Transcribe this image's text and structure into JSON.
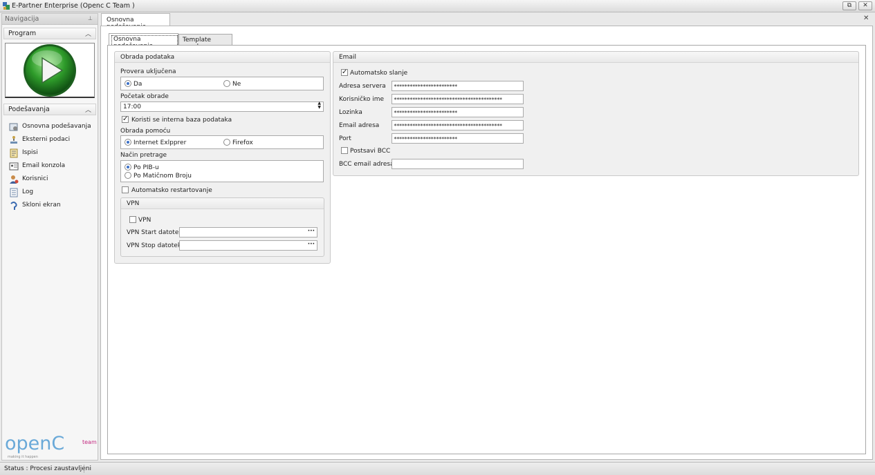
{
  "window": {
    "title": "E-Partner Enterprise (Openc C Team )"
  },
  "nav": {
    "header": "Navigacija",
    "program_group": "Program",
    "settings_group": "Podešavanja",
    "items": [
      {
        "label": "Osnovna podešavanja",
        "icon": "settings-icon"
      },
      {
        "label": "Eksterni podaci",
        "icon": "external-data-icon"
      },
      {
        "label": "Ispisi",
        "icon": "reports-icon"
      },
      {
        "label": "Email konzola",
        "icon": "email-console-icon"
      },
      {
        "label": "Korisnici",
        "icon": "users-icon"
      },
      {
        "label": "Log",
        "icon": "log-icon"
      },
      {
        "label": "Skloni ekran",
        "icon": "hide-screen-icon"
      }
    ],
    "brand_main": "openC",
    "brand_team": "team",
    "brand_tagline": "making it happen"
  },
  "document": {
    "tab_label": "Osnovna podešavanja",
    "tabs": [
      "Osnovna podešavanja",
      "Template poruke"
    ]
  },
  "processing": {
    "title": "Obrada podataka",
    "check_label": "Provera uključena",
    "check_options": [
      "Da",
      "Ne"
    ],
    "check_selected": "Da",
    "start_label": "Početak obrade",
    "start_value": "17:00",
    "internal_db_label": "Koristi se interna baza podataka",
    "internal_db_checked": true,
    "via_label": "Obrada pomoću",
    "via_options": [
      "Internet Exlpprer",
      "Firefox"
    ],
    "via_selected": "Internet Exlpprer",
    "search_label": "Način pretrage",
    "search_options": [
      "Po PIB-u",
      "Po Matičnom Broju"
    ],
    "search_selected": "Po PIB-u",
    "auto_restart_label": "Automatsko restartovanje",
    "auto_restart_checked": false
  },
  "vpn": {
    "title": "VPN",
    "enable_label": "VPN",
    "enabled": false,
    "start_label": "VPN Start datoteka",
    "stop_label": "VPN Stop datoteka",
    "browse_label": "···"
  },
  "email": {
    "title": "Email",
    "auto_send_label": "Automatsko slanje",
    "auto_send_checked": true,
    "server_label": "Adresa servera",
    "server_value": "************************",
    "user_label": "Korisničko ime",
    "user_value": "*****************************************",
    "password_label": "Lozinka",
    "password_value": "************************",
    "address_label": "Email adresa",
    "address_value": "*****************************************",
    "port_label": "Port",
    "port_value": "************************",
    "bcc_flag_label": "Postsavi BCC",
    "bcc_flag_checked": false,
    "bcc_address_label": "BCC email adresa",
    "bcc_address_value": ""
  },
  "status": {
    "text": "Status : Procesi zaustavljeni"
  }
}
